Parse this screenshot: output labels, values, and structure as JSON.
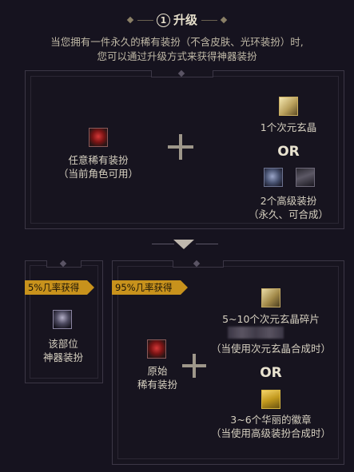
{
  "header": {
    "step_number": "1",
    "title": "升级"
  },
  "intro": {
    "line1": "当您拥有一件永久的稀有装扮（不含皮肤、光环装扮）时,",
    "line2": "您可以通过升级方式来获得神器装扮"
  },
  "top_panel": {
    "input_label_line1": "任意稀有装扮",
    "input_label_line2": "（当前角色可用）",
    "option1_label": "1个次元玄晶",
    "or_label": "OR",
    "option2_label_line1": "2个高级装扮",
    "option2_label_line2": "（永久、可合成）"
  },
  "left_result": {
    "badge": "5%几率获得",
    "label_line1": "该部位",
    "label_line2": "神器装扮"
  },
  "right_result": {
    "badge": "95%几率获得",
    "input_label_line1": "原始",
    "input_label_line2": "稀有装扮",
    "option1_label": "5~10个次元玄晶碎片",
    "option1_note": "（当使用次元玄晶合成时）",
    "or_label": "OR",
    "option2_label": "3~6个华丽的徽章",
    "option2_note": "（当使用高级装扮合成时）"
  },
  "colors": {
    "accent_badge": "#c8921c",
    "background": "#16131f",
    "panel_border": "#3c3746"
  },
  "icons": [
    "rare-costume-icon",
    "dimension-crystal-icon",
    "helmet-costume-icon",
    "armor-costume-icon",
    "artifact-costume-icon",
    "crystal-fragment-icon",
    "medal-icon"
  ]
}
